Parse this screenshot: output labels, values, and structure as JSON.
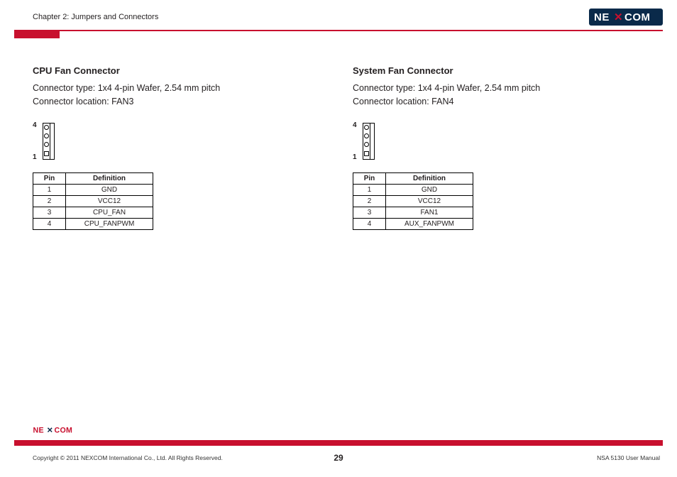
{
  "header": {
    "chapter": "Chapter 2: Jumpers and Connectors"
  },
  "left": {
    "title": "CPU Fan Connector",
    "spec_line1": "Connector type: 1x4 4-pin Wafer, 2.54 mm pitch",
    "spec_line2": "Connector location: FAN3",
    "diagram": {
      "top_label": "4",
      "bottom_label": "1"
    },
    "table": {
      "headers": {
        "pin": "Pin",
        "def": "Definition"
      },
      "rows": [
        {
          "pin": "1",
          "def": "GND"
        },
        {
          "pin": "2",
          "def": "VCC12"
        },
        {
          "pin": "3",
          "def": "CPU_FAN"
        },
        {
          "pin": "4",
          "def": "CPU_FANPWM"
        }
      ]
    }
  },
  "right": {
    "title": "System Fan Connector",
    "spec_line1": "Connector type: 1x4 4-pin Wafer, 2.54 mm pitch",
    "spec_line2": "Connector location: FAN4",
    "diagram": {
      "top_label": "4",
      "bottom_label": "1"
    },
    "table": {
      "headers": {
        "pin": "Pin",
        "def": "Definition"
      },
      "rows": [
        {
          "pin": "1",
          "def": "GND"
        },
        {
          "pin": "2",
          "def": "VCC12"
        },
        {
          "pin": "3",
          "def": "FAN1"
        },
        {
          "pin": "4",
          "def": "AUX_FANPWM"
        }
      ]
    }
  },
  "footer": {
    "copyright": "Copyright © 2011 NEXCOM International Co., Ltd. All Rights Reserved.",
    "page": "29",
    "manual": "NSA 5130 User Manual"
  },
  "brand": {
    "name": "NEXCOM",
    "accent": "#c8102e"
  }
}
